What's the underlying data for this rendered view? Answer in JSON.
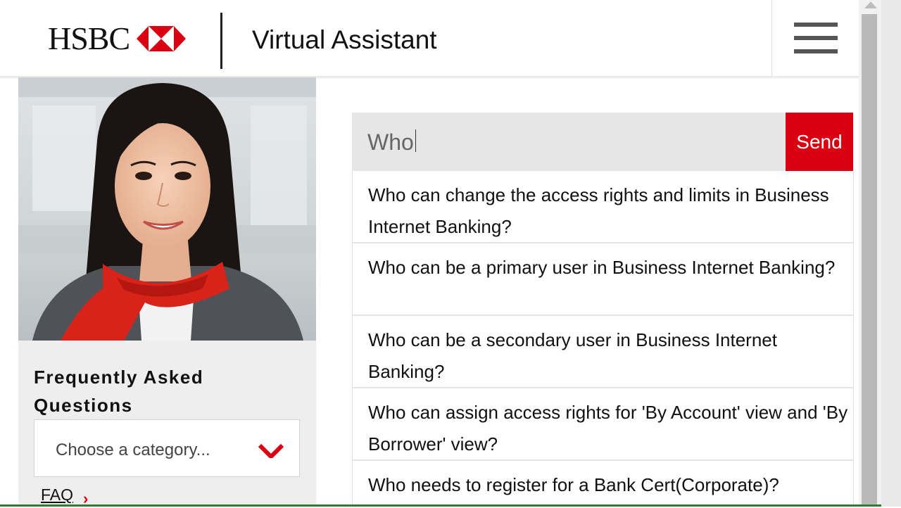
{
  "header": {
    "brand": "HSBC",
    "title": "Virtual Assistant",
    "brand_color": "#db0011"
  },
  "faq": {
    "title": "Frequently Asked Questions",
    "category_select": "Choose a category...",
    "link": "FAQ",
    "link_chevron": "›"
  },
  "search": {
    "value": "Who",
    "send_label": "Send"
  },
  "suggestions": [
    "Who can change the access rights and limits in Business Internet Banking?",
    "Who can be a primary user in Business Internet Banking?",
    "Who can be a secondary user in Business Internet Banking?",
    "Who can assign access rights for 'By Account' view and 'By Borrower' view?",
    "Who needs to register for a Bank Cert(Corporate)?"
  ]
}
